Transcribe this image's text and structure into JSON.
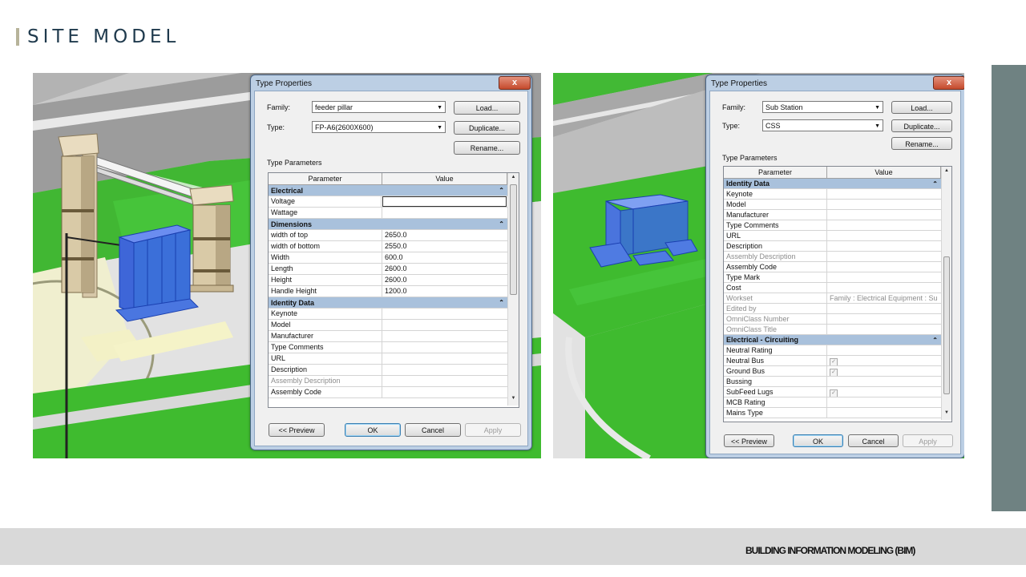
{
  "slide": {
    "title": "SITE MODEL",
    "footer": "BUILDING INFORMATION MODELING (BIM)"
  },
  "colors": {
    "title": "#1f3a4d",
    "accent_band": "#6f8282",
    "footer_bg": "#d9d9d9",
    "section_header": "#a9c1dc",
    "model_blue": "#3b6fd9",
    "grass": "#3fbb2f"
  },
  "dialog_left": {
    "title": "Type Properties",
    "close": "x",
    "family_label": "Family:",
    "family_value": "feeder pillar",
    "type_label": "Type:",
    "type_value": "FP-A6(2600X600)",
    "load": "Load...",
    "duplicate": "Duplicate...",
    "rename": "Rename...",
    "type_parameters": "Type Parameters",
    "col_parameter": "Parameter",
    "col_value": "Value",
    "sections": [
      {
        "name": "Electrical",
        "rows": [
          {
            "p": "Voltage",
            "v": ""
          },
          {
            "p": "Wattage",
            "v": ""
          }
        ]
      },
      {
        "name": "Dimensions",
        "rows": [
          {
            "p": "width of top",
            "v": "2650.0"
          },
          {
            "p": "width of bottom",
            "v": "2550.0"
          },
          {
            "p": "Width",
            "v": "600.0"
          },
          {
            "p": "Length",
            "v": "2600.0"
          },
          {
            "p": "Height",
            "v": "2600.0"
          },
          {
            "p": "Handle Height",
            "v": "1200.0"
          }
        ]
      },
      {
        "name": "Identity Data",
        "rows": [
          {
            "p": "Keynote",
            "v": ""
          },
          {
            "p": "Model",
            "v": ""
          },
          {
            "p": "Manufacturer",
            "v": ""
          },
          {
            "p": "Type Comments",
            "v": ""
          },
          {
            "p": "URL",
            "v": ""
          },
          {
            "p": "Description",
            "v": ""
          },
          {
            "p": "Assembly Description",
            "v": "",
            "grey": true
          },
          {
            "p": "Assembly Code",
            "v": ""
          }
        ]
      }
    ],
    "preview": "<< Preview",
    "ok": "OK",
    "cancel": "Cancel",
    "apply": "Apply"
  },
  "dialog_right": {
    "title": "Type Properties",
    "close": "x",
    "family_label": "Family:",
    "family_value": "Sub Station",
    "type_label": "Type:",
    "type_value": "CSS",
    "load": "Load...",
    "duplicate": "Duplicate...",
    "rename": "Rename...",
    "type_parameters": "Type Parameters",
    "col_parameter": "Parameter",
    "col_value": "Value",
    "sections": [
      {
        "name": "Identity Data",
        "rows": [
          {
            "p": "Keynote",
            "v": ""
          },
          {
            "p": "Model",
            "v": ""
          },
          {
            "p": "Manufacturer",
            "v": ""
          },
          {
            "p": "Type Comments",
            "v": ""
          },
          {
            "p": "URL",
            "v": ""
          },
          {
            "p": "Description",
            "v": ""
          },
          {
            "p": "Assembly Description",
            "v": "",
            "grey": true
          },
          {
            "p": "Assembly Code",
            "v": ""
          },
          {
            "p": "Type Mark",
            "v": ""
          },
          {
            "p": "Cost",
            "v": ""
          },
          {
            "p": "Workset",
            "v": "Family  : Electrical Equipment : Su",
            "grey": true
          },
          {
            "p": "Edited by",
            "v": "",
            "grey": true
          },
          {
            "p": "OmniClass Number",
            "v": "",
            "grey": true
          },
          {
            "p": "OmniClass Title",
            "v": "",
            "grey": true
          }
        ]
      },
      {
        "name": "Electrical - Circuiting",
        "rows": [
          {
            "p": "Neutral Rating",
            "v": ""
          },
          {
            "p": "Neutral Bus",
            "v": "",
            "check": true
          },
          {
            "p": "Ground Bus",
            "v": "",
            "check": true
          },
          {
            "p": "Bussing",
            "v": ""
          },
          {
            "p": "SubFeed Lugs",
            "v": "",
            "check": true
          },
          {
            "p": "MCB Rating",
            "v": ""
          },
          {
            "p": "Mains Type",
            "v": ""
          }
        ]
      }
    ],
    "preview": "<< Preview",
    "ok": "OK",
    "cancel": "Cancel",
    "apply": "Apply"
  }
}
